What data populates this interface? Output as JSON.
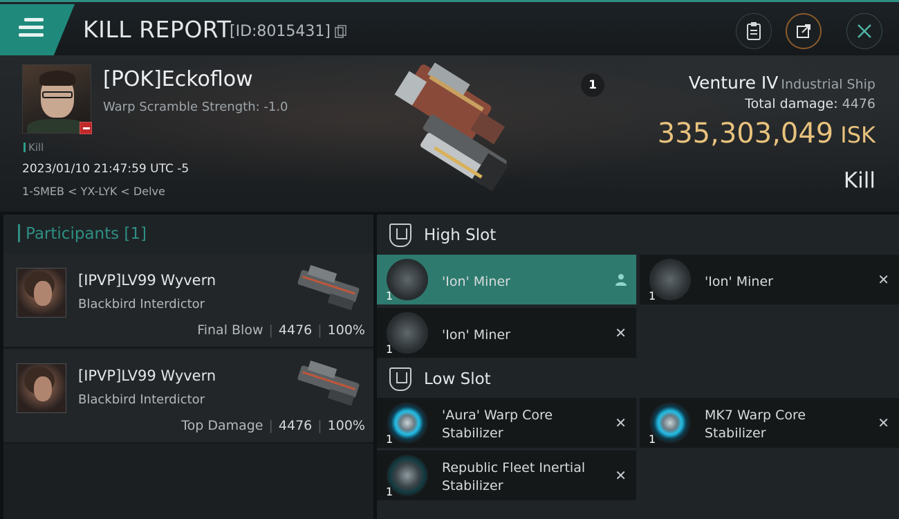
{
  "header": {
    "title": "KILL REPORT",
    "report_id": "[ID:8015431]",
    "icons": {
      "menu": "hamburger-menu-icon",
      "copy": "copy-icon",
      "clipboard": "clipboard-icon",
      "share": "share-icon",
      "close": "close-icon"
    }
  },
  "victim": {
    "name": "[POK]Eckoflow",
    "warp_scramble": "Warp Scramble Strength: -1.0",
    "kill_tag": "Kill",
    "datetime": "2023/01/10 21:47:59 UTC -5",
    "location": "1-SMEB < YX-LYK < Delve",
    "ship_name": "Venture IV",
    "ship_class": "Industrial Ship",
    "total_damage_label": "Total damage:",
    "total_damage": "4476",
    "isk_value": "335,303,049",
    "isk_unit": "ISK",
    "result": "Kill",
    "participant_count_badge": "1"
  },
  "participants": {
    "header": "Participants [1]",
    "rows": [
      {
        "name": "[IPVP]LV99 Wyvern",
        "ship": "Blackbird Interdictor",
        "label": "Final Blow",
        "damage": "4476",
        "percent": "100%"
      },
      {
        "name": "[IPVP]LV99 Wyvern",
        "ship": "Blackbird Interdictor",
        "label": "Top Damage",
        "damage": "4476",
        "percent": "100%"
      }
    ]
  },
  "slots": {
    "high": {
      "title": "High Slot",
      "items": [
        {
          "name": "'Ion' Miner",
          "qty": "1",
          "status": "user"
        },
        {
          "name": "'Ion' Miner",
          "qty": "1",
          "status": "x"
        },
        {
          "name": "'Ion' Miner",
          "qty": "1",
          "status": "x"
        }
      ]
    },
    "low": {
      "title": "Low Slot",
      "items": [
        {
          "name_line1": "'Aura' Warp Core",
          "name_line2": "Stabilizer",
          "qty": "1",
          "status": "x"
        },
        {
          "name_line1": "MK7 Warp Core",
          "name_line2": "Stabilizer",
          "qty": "1",
          "status": "x"
        },
        {
          "name_line1": "Republic Fleet Inertial",
          "name_line2": "Stabilizer",
          "qty": "1",
          "status": "x"
        }
      ]
    },
    "x_symbol": "✕"
  }
}
